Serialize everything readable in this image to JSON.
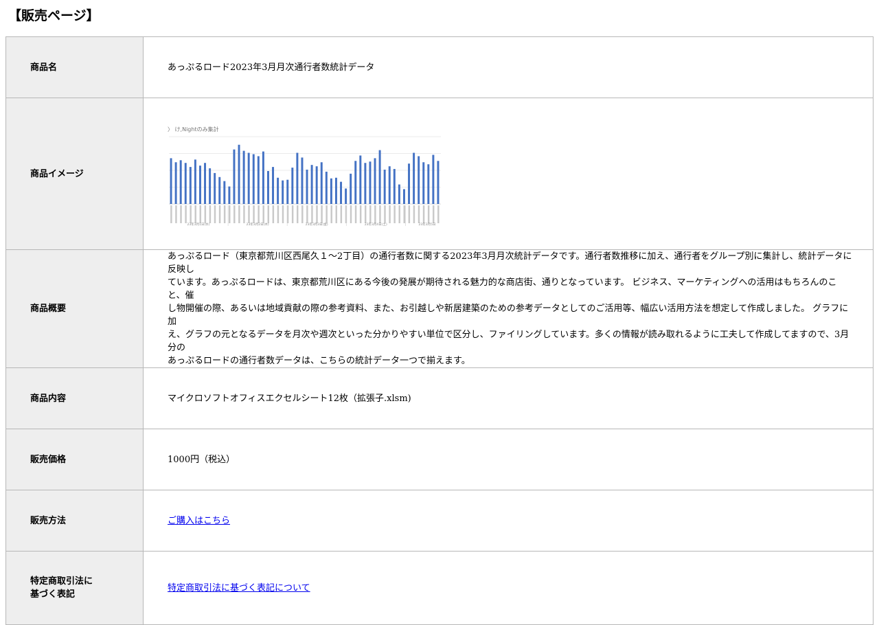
{
  "page": {
    "title": "【販売ページ】"
  },
  "rows": {
    "name": {
      "label": "商品名",
      "value": "あっぷるロード2023年3月月次通行者数統計データ"
    },
    "image": {
      "label": "商品イメージ",
      "thumbnail_title": "〉 け,Nightのみ集計",
      "day_labels": [
        "23年3月1日(水)",
        "23年3月2日(木)",
        "23年3月3日(金)",
        "23年3月4日(土)",
        "23年3月5日"
      ],
      "bar_color": "#4472c4",
      "bars": [
        68,
        62,
        65,
        61,
        55,
        66,
        57,
        61,
        53,
        46,
        40,
        34,
        26,
        81,
        88,
        79,
        76,
        74,
        71,
        78,
        49,
        55,
        39,
        35,
        36,
        54,
        76,
        69,
        51,
        58,
        56,
        62,
        48,
        38,
        39,
        33,
        23,
        45,
        64,
        72,
        61,
        63,
        68,
        80,
        51,
        56,
        52,
        29,
        22,
        60,
        76,
        71,
        62,
        59,
        73,
        64
      ]
    },
    "summary": {
      "label": "商品概要",
      "lines": [
        "あっぷるロード（東京都荒川区西尾久１～2丁目）の通行者数に関する2023年3月月次統計データです。通行者数推移に加え、通行者をグループ別に集計し、統計データに反映し",
        "ています。あっぷるロードは、東京都荒川区にある今後の発展が期待される魅力的な商店街、通りとなっています。 ビジネス、マーケティングへの活用はもちろんのこと、催",
        "し物開催の際、あるいは地域貢献の際の参考資料、また、お引越しや新居建築のための参考データとしてのご活用等、幅広い活用方法を想定して作成しました。 グラフに加",
        "え、グラフの元となるデータを月次や週次といった分かりやすい単位で区分し、ファイリングしています。多くの情報が読み取れるように工夫して作成してますので、3月分の",
        "あっぷるロードの通行者数データは、こちらの統計データ一つで揃えます。"
      ]
    },
    "content": {
      "label": "商品内容",
      "value": "マイクロソフトオフィスエクセルシート12枚（拡張子.xlsm)"
    },
    "price": {
      "label": "販売価格",
      "value": "1000円（税込）"
    },
    "method": {
      "label": "販売方法",
      "link": "ご購入はこちら"
    },
    "law": {
      "label_line1": "特定商取引法に",
      "label_line2": "基づく表記",
      "link": "特定商取引法に基づく表記について"
    }
  }
}
